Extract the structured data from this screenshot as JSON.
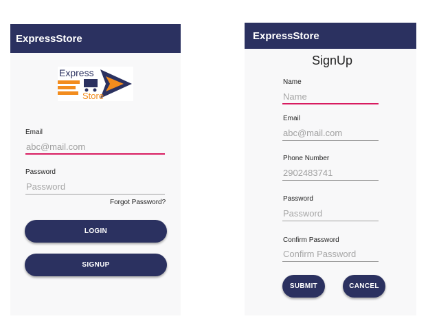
{
  "login": {
    "app_title": "ExpressStore",
    "logo_text_top": "Express",
    "logo_text_bottom": "Store",
    "email_label": "Email",
    "email_value": "abc@mail.com",
    "password_label": "Password",
    "password_placeholder": "Password",
    "forgot_password": "Forgot Password?",
    "login_button": "LOGIN",
    "signup_button": "SIGNUP"
  },
  "signup": {
    "app_title": "ExpressStore",
    "title": "SignUp",
    "name_label": "Name",
    "name_placeholder": "Name",
    "email_label": "Email",
    "email_value": "abc@mail.com",
    "phone_label": "Phone Number",
    "phone_value": "2902483741",
    "password_label": "Password",
    "password_placeholder": "Password",
    "confirm_label": "Confirm Password",
    "confirm_placeholder": "Confirm Password",
    "submit_button": "SUBMIT",
    "cancel_button": "CANCEL"
  },
  "colors": {
    "primary": "#2b3160",
    "accent": "#d81b60",
    "logo_orange": "#f28c1e"
  }
}
